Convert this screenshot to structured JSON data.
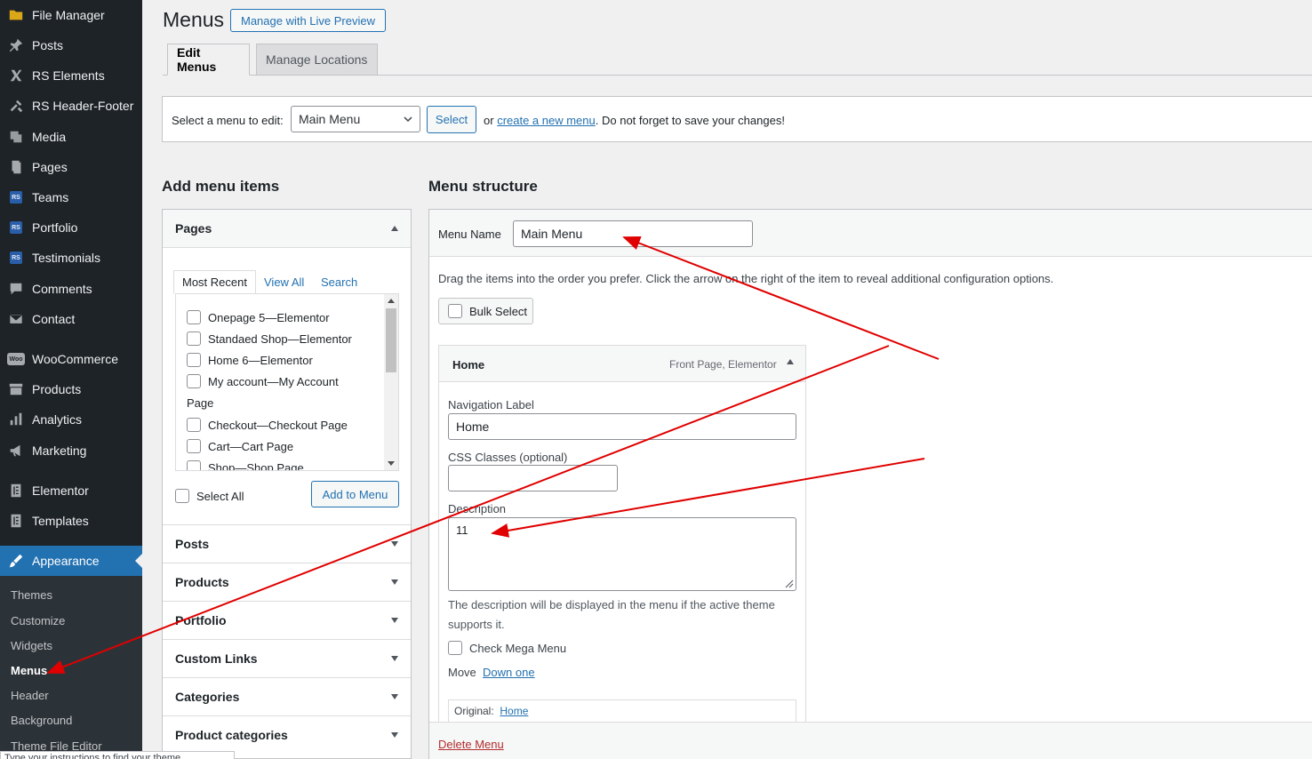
{
  "sidebar": {
    "items": [
      {
        "label": "File Manager",
        "icon": "folder-icon"
      },
      {
        "label": "Posts",
        "icon": "pin-icon"
      },
      {
        "label": "RS Elements",
        "icon": "x-icon"
      },
      {
        "label": "RS Header-Footer",
        "icon": "tools-icon"
      },
      {
        "label": "Media",
        "icon": "media-icon"
      },
      {
        "label": "Pages",
        "icon": "pages-icon"
      },
      {
        "label": "Teams",
        "icon": "rs-icon"
      },
      {
        "label": "Portfolio",
        "icon": "rs-icon"
      },
      {
        "label": "Testimonials",
        "icon": "rs-icon"
      },
      {
        "label": "Comments",
        "icon": "comment-icon"
      },
      {
        "label": "Contact",
        "icon": "mail-icon"
      },
      {
        "label": "WooCommerce",
        "icon": "woo-icon"
      },
      {
        "label": "Products",
        "icon": "archive-icon"
      },
      {
        "label": "Analytics",
        "icon": "bar-chart-icon"
      },
      {
        "label": "Marketing",
        "icon": "megaphone-icon"
      },
      {
        "label": "Elementor",
        "icon": "elementor-icon"
      },
      {
        "label": "Templates",
        "icon": "templates-icon"
      },
      {
        "label": "Appearance",
        "icon": "brush-icon"
      }
    ],
    "rs_badge": "RS",
    "woo_badge": "Woo",
    "submenu": [
      "Themes",
      "Customize",
      "Widgets",
      "Menus",
      "Header",
      "Background",
      "Theme File Editor"
    ]
  },
  "header": {
    "title": "Menus",
    "live_preview": "Manage with Live Preview",
    "tabs": [
      "Edit Menus",
      "Manage Locations"
    ]
  },
  "select_bar": {
    "label": "Select a menu to edit:",
    "selected": "Main Menu",
    "button": "Select",
    "or": "or",
    "create_link": "create a new menu",
    "suffix": ". Do not forget to save your changes!"
  },
  "add_items": {
    "heading": "Add menu items",
    "pages_title": "Pages",
    "inner_tabs": [
      "Most Recent",
      "View All",
      "Search"
    ],
    "pages": [
      {
        "name": "Onepage 5",
        "type": "Elementor"
      },
      {
        "name": "Standaed Shop",
        "type": "Elementor"
      },
      {
        "name": "Home 6",
        "type": "Elementor"
      },
      {
        "name": "My account",
        "type": "My Account Page"
      },
      {
        "name": "Checkout",
        "type": "Checkout Page"
      },
      {
        "name": "Cart",
        "type": "Cart Page"
      },
      {
        "name": "Shop",
        "type": "Shop Page"
      }
    ],
    "dash": " — ",
    "page_word": "Page",
    "my_account_type": "My Account",
    "select_all": "Select All",
    "add_button": "Add to Menu",
    "sections": [
      "Posts",
      "Products",
      "Portfolio",
      "Custom Links",
      "Categories",
      "Product categories"
    ]
  },
  "structure": {
    "heading": "Menu structure",
    "name_label": "Menu Name",
    "name_value": "Main Menu",
    "instructions": "Drag the items into the order you prefer. Click the arrow on the right of the item to reveal additional configuration options.",
    "bulk_select": "Bulk Select",
    "item": {
      "title": "Home",
      "type": "Front Page, Elementor",
      "nav_label_label": "Navigation Label",
      "nav_label_value": "Home",
      "css_label": "CSS Classes (optional)",
      "css_value": "",
      "desc_label": "Description",
      "desc_value": "11",
      "desc_help": "The description will be displayed in the menu if the active theme supports it.",
      "mega_label": "Check Mega Menu",
      "move_label": "Move",
      "move_link": "Down one",
      "original_label": "Original:",
      "original_link": "Home"
    },
    "delete": "Delete Menu"
  },
  "tooltip_fragment": "Type your instructions to find your theme",
  "colors": {
    "sidebar_bg": "#1d2327",
    "accent": "#2271b1",
    "annotation": "#e00000",
    "danger": "#b32d2e"
  }
}
